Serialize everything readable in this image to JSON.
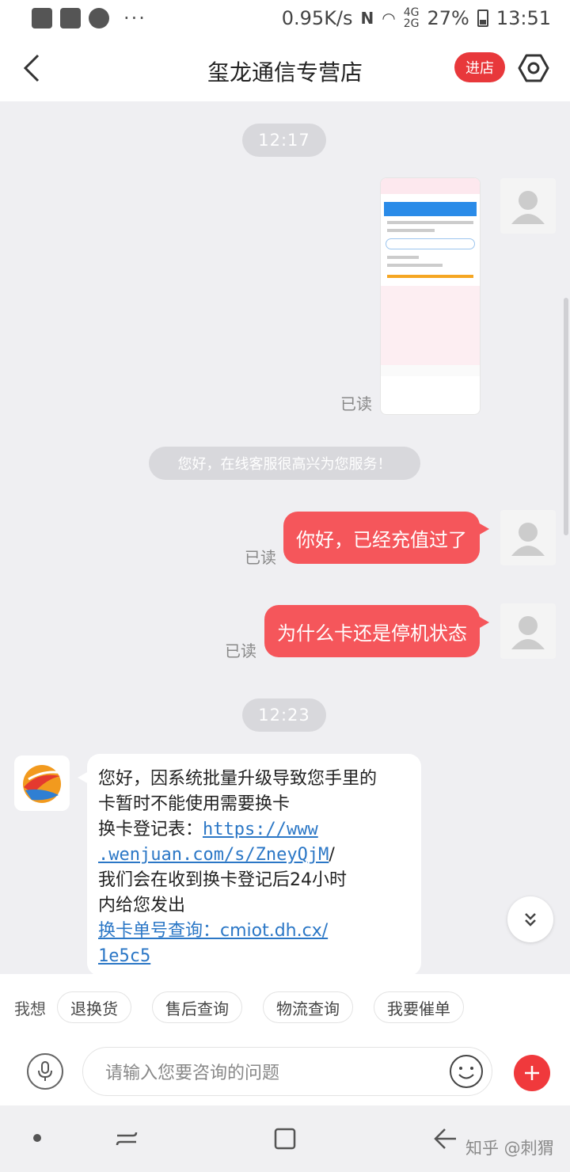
{
  "status_bar": {
    "speed": "0.95K/s",
    "network": "4G 2G",
    "battery": "27%",
    "time": "13:51",
    "dots": "···"
  },
  "header": {
    "title": "玺龙通信专营店",
    "enter_store": "进店"
  },
  "chat": {
    "time1": "12:17",
    "time2": "12:23",
    "read_label": "已读",
    "system_message": "您好，在线客服很高兴为您服务！",
    "outgoing": [
      "你好，已经充值过了",
      "为什么卡还是停机状态"
    ],
    "incoming": {
      "line1": "您好，因系统批量升级导致您手里的",
      "line2": "卡暂时不能使用需要换卡",
      "line3_label": "换卡登记表：",
      "link1_part1": "https://www",
      "link1_part2": ".wenjuan.com/s/ZneyQjM",
      "slash": "/",
      "line4": "我们会在收到换卡登记后24小时",
      "line5": "内给您发出",
      "link2_part1": "换卡单号查询：cmiot.dh.cx/",
      "link2_part2": "1e5c5"
    }
  },
  "quick_bar": {
    "label": "我想",
    "chips": [
      "退换货",
      "售后查询",
      "物流查询",
      "我要催单"
    ]
  },
  "input": {
    "placeholder": "请输入您要咨询的问题"
  },
  "watermark": "知乎 @刺猬",
  "colors": {
    "accent": "#f5565b",
    "link": "#2b77c6",
    "background": "#efeff2"
  }
}
